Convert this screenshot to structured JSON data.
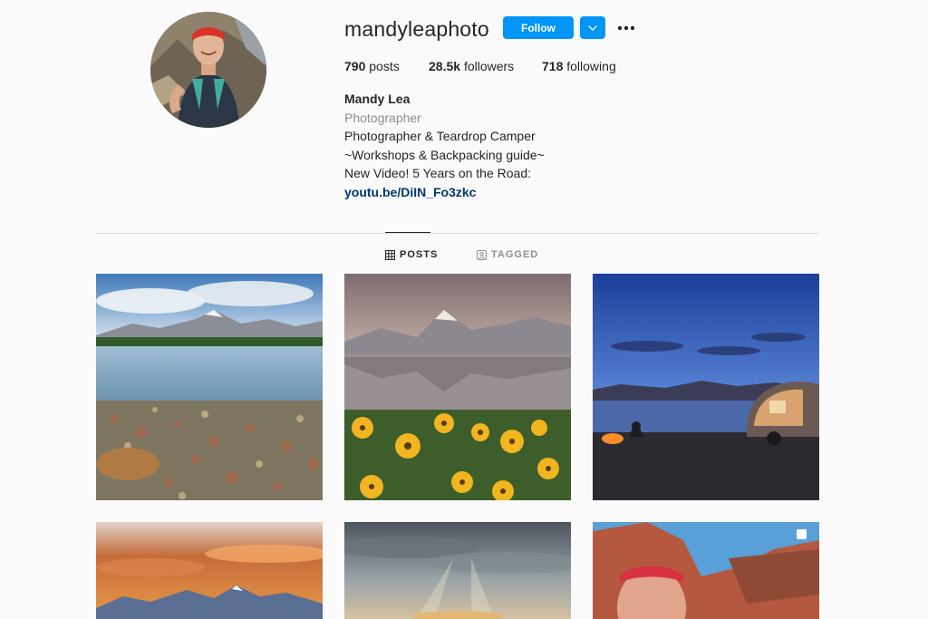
{
  "profile": {
    "username": "mandyleaphoto",
    "follow_label": "Follow",
    "posts_count": "790",
    "posts_label": "posts",
    "followers_count": "28.5k",
    "followers_label": "followers",
    "following_count": "718",
    "following_label": "following",
    "full_name": "Mandy Lea",
    "category": "Photographer",
    "bio_lines": [
      "Photographer & Teardrop Camper",
      "~Workshops & Backpacking guide~",
      "New Video! 5 Years on the Road:"
    ],
    "link": "youtu.be/DiIN_Fo3zkc"
  },
  "tabs": {
    "posts_label": "POSTS",
    "tagged_label": "TAGGED",
    "active": "posts"
  },
  "colors": {
    "accent": "#0095f6",
    "link": "#00376b",
    "muted": "#8e8e8e",
    "text": "#262626"
  },
  "icons": {
    "dropdown": "chevron-down-icon",
    "more": "more-horizontal-icon",
    "posts_tab": "grid-icon",
    "tagged_tab": "tagged-person-icon",
    "multi_post": "carousel-icon"
  },
  "posts": [
    {
      "name": "post-mountain-lake-pebbles"
    },
    {
      "name": "post-mountain-lake-sunflowers"
    },
    {
      "name": "post-teardrop-camper-night"
    },
    {
      "name": "post-sunset-mountain-peaks"
    },
    {
      "name": "post-clouds-sunrays"
    },
    {
      "name": "post-canyon-selfie",
      "multi": true
    }
  ]
}
